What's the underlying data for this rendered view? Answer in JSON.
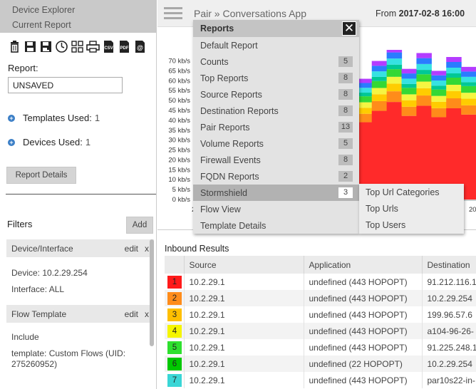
{
  "sidebar": {
    "nav": [
      "Device Explorer",
      "Current Report"
    ],
    "toolbar_icons": [
      "trash-icon",
      "save-icon",
      "save-as-icon",
      "clock-icon",
      "grid-icon",
      "print-icon",
      "csv-icon",
      "pdf-icon",
      "email-icon"
    ],
    "csv_text": "CSV",
    "pdf_text": "PDF",
    "email_text": "@",
    "report_label": "Report:",
    "report_value": "UNSAVED",
    "templates_used_label": "Templates Used:",
    "templates_used_count": "1",
    "devices_used_label": "Devices Used:",
    "devices_used_count": "1",
    "report_details_label": "Report Details",
    "filters_title": "Filters",
    "add_label": "Add",
    "edit_label": "edit",
    "close_label": "x",
    "filter_cards": [
      {
        "title": "Device/Interface",
        "lines": [
          "Device: 10.2.29.254",
          "Interface: ALL"
        ]
      },
      {
        "title": "Flow Template",
        "lines": [
          "Include",
          "template: Custom Flows (UID: 275260952)"
        ]
      }
    ]
  },
  "header": {
    "breadcrumb": "Pair » Conversations App",
    "from_label": "From",
    "from_value": "2017-02-8 16:00"
  },
  "menu": {
    "title": "Reports",
    "close_label": "✕",
    "items": [
      {
        "label": "Default Report",
        "count": ""
      },
      {
        "label": "Counts",
        "count": "5"
      },
      {
        "label": "Top Reports",
        "count": "8"
      },
      {
        "label": "Source Reports",
        "count": "8"
      },
      {
        "label": "Destination Reports",
        "count": "8"
      },
      {
        "label": "Pair Reports",
        "count": "13"
      },
      {
        "label": "Volume Reports",
        "count": "5"
      },
      {
        "label": "Firewall Events",
        "count": "8"
      },
      {
        "label": "FQDN Reports",
        "count": "2"
      },
      {
        "label": "Stormshield",
        "count": "3"
      },
      {
        "label": "Flow View",
        "count": ""
      },
      {
        "label": "Template Details",
        "count": ""
      }
    ],
    "submenu": [
      "Top Url Categories",
      "Top Urls",
      "Top Users"
    ]
  },
  "chart_data": {
    "type": "area",
    "stacked": true,
    "yticks": [
      "70 kb/s",
      "65 kb/s",
      "60 kb/s",
      "55 kb/s",
      "50 kb/s",
      "45 kb/s",
      "40 kb/s",
      "35 kb/s",
      "30 kb/s",
      "25 kb/s",
      "20 kb/s",
      "15 kb/s",
      "10 kb/s",
      "5 kb/s",
      "0 kb/s"
    ],
    "ylim": [
      0,
      72
    ],
    "xticks_visible": [
      "2",
      "20"
    ],
    "series_colors": [
      "#ff2a2a",
      "#ff8c1a",
      "#ffcc00",
      "#f5f542",
      "#35d835",
      "#00c896",
      "#36e2e2",
      "#2a7cff",
      "#b43cff",
      "#ff4fd0"
    ],
    "column_totals": [
      78,
      78,
      63,
      63,
      71,
      71,
      76,
      76,
      68,
      68,
      75,
      75,
      64,
      64,
      79,
      79,
      73,
      73,
      69,
      69,
      75,
      75,
      61,
      61,
      70,
      70,
      77,
      77,
      66,
      66,
      74,
      74,
      65,
      65,
      72,
      72,
      67,
      67
    ]
  },
  "results": {
    "title": "Inbound Results",
    "columns": [
      "",
      "Source",
      "Application",
      "Destination"
    ],
    "row_colors": [
      "#ff1a1a",
      "#ff8c1a",
      "#ffbf00",
      "#f5f500",
      "#2ee02e",
      "#00c800",
      "#3ad6d6"
    ],
    "rows": [
      [
        "1",
        "10.2.29.1",
        "undefined (443 HOPOPT)",
        "91.212.116.1"
      ],
      [
        "2",
        "10.2.29.1",
        "undefined (443 HOPOPT)",
        "10.2.29.254"
      ],
      [
        "3",
        "10.2.29.1",
        "undefined (443 HOPOPT)",
        "199.96.57.6"
      ],
      [
        "4",
        "10.2.29.1",
        "undefined (443 HOPOPT)",
        "a104-96-26-"
      ],
      [
        "5",
        "10.2.29.1",
        "undefined (443 HOPOPT)",
        "91.225.248.1"
      ],
      [
        "6",
        "10.2.29.1",
        "undefined (22 HOPOPT)",
        "10.2.29.254"
      ],
      [
        "7",
        "10.2.29.1",
        "undefined (443 HOPOPT)",
        "par10s22-in-"
      ]
    ]
  }
}
